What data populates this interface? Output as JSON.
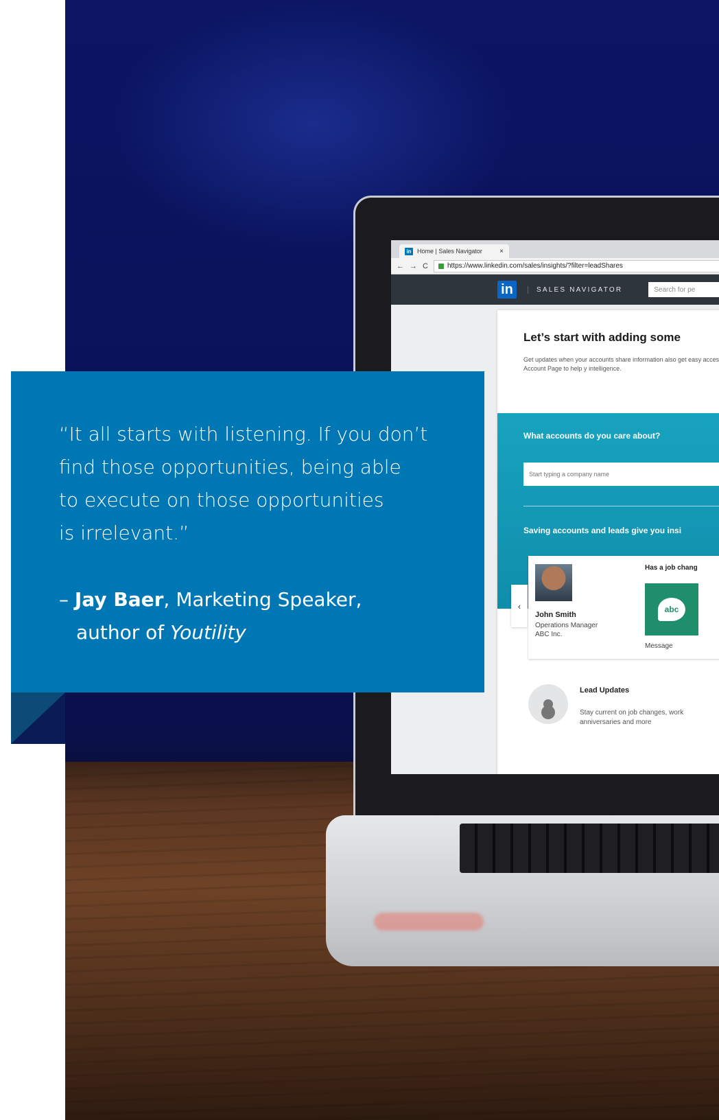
{
  "quote": {
    "lines": [
      "“It all starts with listening. If you don’t",
      " find those opportunities, being able",
      " to execute on those opportunities",
      " is irrelevant.”"
    ],
    "dash": "– ",
    "name": "Jay Baer",
    "role": ", Marketing Speaker,",
    "author_prefix": "author of ",
    "book": "Youtility"
  },
  "browser": {
    "tab_title": "Home | Sales Navigator",
    "tab_close": "×",
    "url": "https://www.linkedin.com/sales/insights/?filter=leadShares",
    "back": "←",
    "forward": "→",
    "reload": "C"
  },
  "app": {
    "logo": "in",
    "brand": "SALES NAVIGATOR",
    "search_placeholder": "Search for pe",
    "heading": "Let’s start with adding some",
    "subtext": "Get updates when your accounts share information also get easy access to the Account Page to help y intelligence.",
    "question": "What accounts do you care about?",
    "company_placeholder": "Start typing a company name",
    "saving": "Saving accounts and leads give you insi",
    "chevron": "‹",
    "lead": {
      "name": "John Smith",
      "title": "Operations Manager",
      "company": "ABC Inc.",
      "job_change": "Has a job chang",
      "logo_text": "abc",
      "message": "Message"
    },
    "lead_updates": {
      "title": "Lead Updates",
      "desc": "Stay current on job changes, work anniversaries and more"
    }
  },
  "colors": {
    "quote_box": "#0077b5",
    "fold": "#0c4a78",
    "teal": "#18a3bf"
  }
}
